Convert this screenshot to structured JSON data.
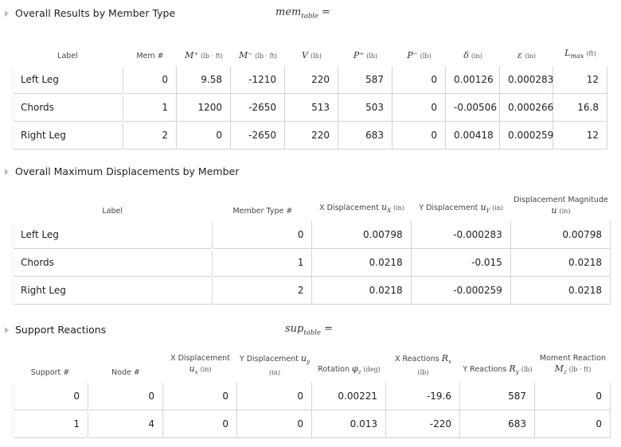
{
  "sections": {
    "members": {
      "title": "Overall Results by Member Type",
      "var_name": "mem",
      "var_sub": "table",
      "equals": "=",
      "headers": {
        "label": "Label",
        "mem": "Mem #",
        "mplus_sym": "M⁺",
        "mplus_unit": "(lb · ft)",
        "mminus_sym": "M⁻",
        "mminus_unit": "(lb · ft)",
        "v_sym": "V",
        "v_unit": "(lb)",
        "pplus_sym": "P⁺",
        "pplus_unit": "(lb)",
        "pminus_sym": "P⁻",
        "pminus_unit": "(lb)",
        "delta_sym": "δ",
        "delta_unit": "(in)",
        "eps_sym": "ε",
        "eps_unit": "(in)",
        "lmax_sym": "L",
        "lmax_sub": "max",
        "lmax_unit": "(ft)"
      },
      "rows": [
        {
          "label": "Left Leg",
          "mem": "0",
          "mplus": "9.58",
          "mminus": "-1210",
          "v": "220",
          "pplus": "587",
          "pminus": "0",
          "delta": "0.00126",
          "eps": "0.000283",
          "lmax": "12"
        },
        {
          "label": "Chords",
          "mem": "1",
          "mplus": "1200",
          "mminus": "-2650",
          "v": "513",
          "pplus": "503",
          "pminus": "0",
          "delta": "-0.00506",
          "eps": "0.000266",
          "lmax": "16.8"
        },
        {
          "label": "Right Leg",
          "mem": "2",
          "mplus": "0",
          "mminus": "-2650",
          "v": "220",
          "pplus": "683",
          "pminus": "0",
          "delta": "0.00418",
          "eps": "0.000259",
          "lmax": "12"
        }
      ]
    },
    "displacements": {
      "title": "Overall Maximum Displacements by Member",
      "headers": {
        "label": "Label",
        "type": "Member Type #",
        "ux_text": "X Displacement",
        "ux_sym": "u",
        "ux_sub": "X",
        "ux_unit": "(in)",
        "uy_text": "Y Displacement",
        "uy_sym": "u",
        "uy_sub": "Y",
        "uy_unit": "(in)",
        "mag_text": "Displacement Magnitude",
        "mag_sym": "u",
        "mag_unit": "(in)"
      },
      "rows": [
        {
          "label": "Left Leg",
          "type": "0",
          "ux": "0.00798",
          "uy": "-0.000283",
          "mag": "0.00798"
        },
        {
          "label": "Chords",
          "type": "1",
          "ux": "0.0218",
          "uy": "-0.015",
          "mag": "0.0218"
        },
        {
          "label": "Right Leg",
          "type": "2",
          "ux": "0.0218",
          "uy": "-0.000259",
          "mag": "0.0218"
        }
      ]
    },
    "supports": {
      "title": "Support Reactions",
      "var_name": "sup",
      "var_sub": "table",
      "equals": "=",
      "headers": {
        "support": "Support #",
        "node": "Node #",
        "ux_text": "X Displacement",
        "ux_sym": "u",
        "ux_sub": "x",
        "ux_unit": "(in)",
        "uy_text": "Y Displacement",
        "uy_sym": "u",
        "uy_sub": "y",
        "uy_unit": "(in)",
        "rot_text": "Rotation",
        "rot_sym": "φ",
        "rot_sub": "z",
        "rot_unit": "(deg)",
        "rx_text": "X Reactions",
        "rx_sym": "R",
        "rx_sub": "x",
        "rx_unit": "(lb)",
        "ry_text": "Y Reactions",
        "ry_sym": "R",
        "ry_sub": "y",
        "ry_unit": "(lb)",
        "mz_text": "Moment Reaction",
        "mz_sym": "M",
        "mz_sub": "z",
        "mz_unit": "(lb · ft)"
      },
      "rows": [
        {
          "support": "0",
          "node": "0",
          "ux": "0",
          "uy": "0",
          "rot": "0.00221",
          "rx": "-19.6",
          "ry": "587",
          "mz": "0"
        },
        {
          "support": "1",
          "node": "4",
          "ux": "0",
          "uy": "0",
          "rot": "0.013",
          "rx": "-220",
          "ry": "683",
          "mz": "0"
        }
      ]
    }
  }
}
